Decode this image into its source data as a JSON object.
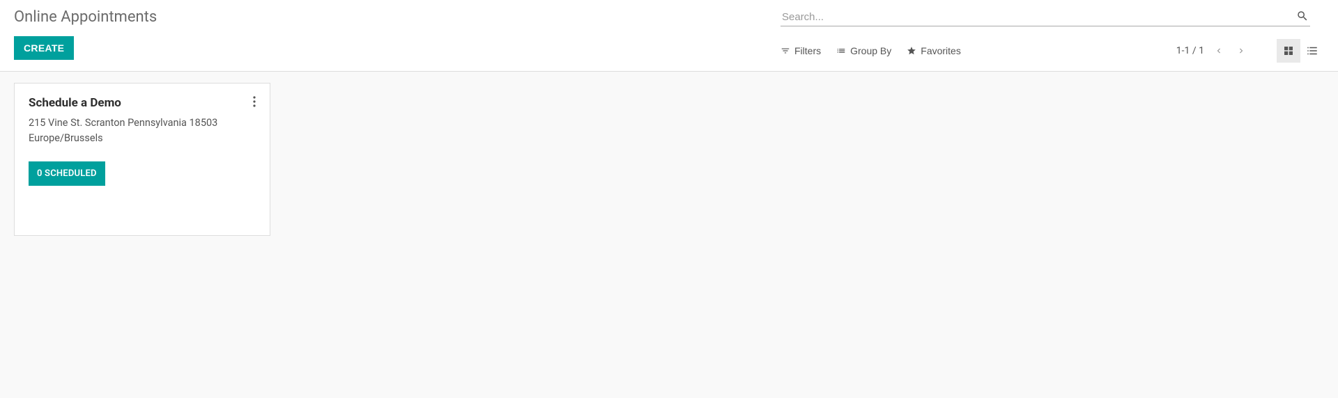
{
  "header": {
    "title": "Online Appointments",
    "create_label": "CREATE"
  },
  "search": {
    "placeholder": "Search..."
  },
  "filters": {
    "filters_label": "Filters",
    "groupby_label": "Group By",
    "favorites_label": "Favorites"
  },
  "pager": {
    "range": "1-1 / 1"
  },
  "records": [
    {
      "title": "Schedule a Demo",
      "location": "215 Vine St. Scranton Pennsylvania 18503",
      "timezone": "Europe/Brussels",
      "badge": "0 SCHEDULED"
    }
  ]
}
